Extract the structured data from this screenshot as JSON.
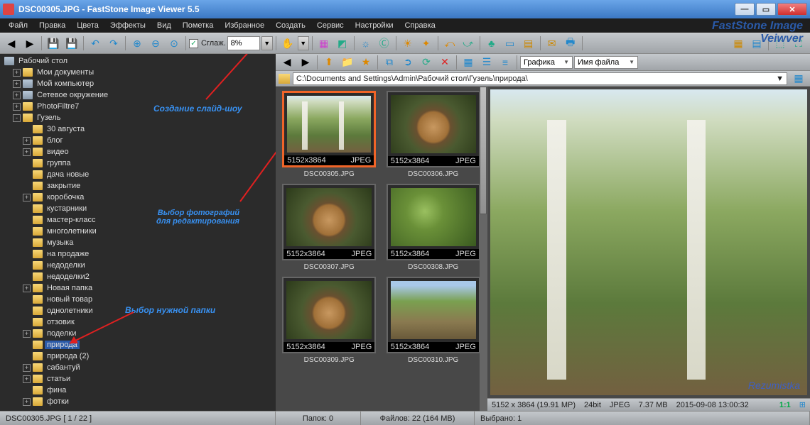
{
  "title": "DSC00305.JPG  -  FastStone Image Viewer 5.5",
  "brand1": "FastStone Image",
  "brand2": "Veiwver",
  "menu": [
    "Файл",
    "Правка",
    "Цвета",
    "Эффекты",
    "Вид",
    "Пометка",
    "Избранное",
    "Создать",
    "Сервис",
    "Настройки",
    "Справка"
  ],
  "toolbar": {
    "smooth_label": "Сглаж.",
    "zoom": "8%"
  },
  "tree_header": "Рабочий стол",
  "tree": [
    {
      "lv": 1,
      "exp": "+",
      "icon": "folder",
      "label": "Мои документы"
    },
    {
      "lv": 1,
      "exp": "+",
      "icon": "drive",
      "label": "Мой компьютер"
    },
    {
      "lv": 1,
      "exp": "+",
      "icon": "drive",
      "label": "Сетевое окружение"
    },
    {
      "lv": 1,
      "exp": "+",
      "icon": "folder",
      "label": "PhotoFiltre7"
    },
    {
      "lv": 1,
      "exp": "-",
      "icon": "folder",
      "label": "Гузель"
    },
    {
      "lv": 2,
      "exp": " ",
      "icon": "folder",
      "label": "30 августа"
    },
    {
      "lv": 2,
      "exp": "+",
      "icon": "folder",
      "label": "блог"
    },
    {
      "lv": 2,
      "exp": "+",
      "icon": "folder",
      "label": "видео"
    },
    {
      "lv": 2,
      "exp": " ",
      "icon": "folder",
      "label": "группа"
    },
    {
      "lv": 2,
      "exp": " ",
      "icon": "folder",
      "label": "дача новые"
    },
    {
      "lv": 2,
      "exp": " ",
      "icon": "folder",
      "label": "закрытие"
    },
    {
      "lv": 2,
      "exp": "+",
      "icon": "folder",
      "label": "коробочка"
    },
    {
      "lv": 2,
      "exp": " ",
      "icon": "folder",
      "label": "кустарники"
    },
    {
      "lv": 2,
      "exp": " ",
      "icon": "folder",
      "label": "мастер-класс"
    },
    {
      "lv": 2,
      "exp": " ",
      "icon": "folder",
      "label": "многолетники"
    },
    {
      "lv": 2,
      "exp": " ",
      "icon": "folder",
      "label": "музыка"
    },
    {
      "lv": 2,
      "exp": " ",
      "icon": "folder",
      "label": "на продаже"
    },
    {
      "lv": 2,
      "exp": " ",
      "icon": "folder",
      "label": "недоделки"
    },
    {
      "lv": 2,
      "exp": " ",
      "icon": "folder",
      "label": "недоделки2"
    },
    {
      "lv": 2,
      "exp": "+",
      "icon": "folder",
      "label": "Новая папка"
    },
    {
      "lv": 2,
      "exp": " ",
      "icon": "folder",
      "label": "новый товар"
    },
    {
      "lv": 2,
      "exp": " ",
      "icon": "folder",
      "label": "однолетники"
    },
    {
      "lv": 2,
      "exp": " ",
      "icon": "folder",
      "label": "отзовик"
    },
    {
      "lv": 2,
      "exp": "+",
      "icon": "folder",
      "label": "поделки"
    },
    {
      "lv": 2,
      "exp": " ",
      "icon": "folder",
      "label": "природа",
      "sel": true
    },
    {
      "lv": 2,
      "exp": " ",
      "icon": "folder",
      "label": "природа (2)"
    },
    {
      "lv": 2,
      "exp": "+",
      "icon": "folder",
      "label": "сабантуй"
    },
    {
      "lv": 2,
      "exp": "+",
      "icon": "folder",
      "label": "статьи"
    },
    {
      "lv": 2,
      "exp": " ",
      "icon": "folder",
      "label": "фина"
    },
    {
      "lv": 2,
      "exp": "+",
      "icon": "folder",
      "label": "фотки"
    }
  ],
  "annotations": {
    "a1": "Создание слайд-шоу",
    "a2_l1": "Выбор фотографий",
    "a2_l2": "для редактирования",
    "a3": "Выбор нужной папки"
  },
  "secondary": {
    "combo1": "Графика",
    "combo2": "Имя файла"
  },
  "path": "C:\\Documents and Settings\\Admin\\Рабочий стол\\Гузель\\природа\\",
  "thumbs": [
    {
      "name": "DSC00305.JPG",
      "dim": "5152x3864",
      "fmt": "JPEG",
      "sel": true,
      "cls": "forest"
    },
    {
      "name": "DSC00306.JPG",
      "dim": "5152x3864",
      "fmt": "JPEG",
      "cls": "mush"
    },
    {
      "name": "DSC00307.JPG",
      "dim": "5152x3864",
      "fmt": "JPEG",
      "cls": "mush"
    },
    {
      "name": "DSC00308.JPG",
      "dim": "5152x3864",
      "fmt": "JPEG",
      "cls": "moss"
    },
    {
      "name": "DSC00309.JPG",
      "dim": "5152x3864",
      "fmt": "JPEG",
      "cls": "mush"
    },
    {
      "name": "DSC00310.JPG",
      "dim": "5152x3864",
      "fmt": "JPEG",
      "cls": "path"
    }
  ],
  "preview": {
    "watermark": "Rezumistka",
    "info": {
      "dims": "5152 x 3864 (19.91 MP)",
      "depth": "24bit",
      "fmt": "JPEG",
      "size": "7.37 MB",
      "date": "2015-09-08 13:00:32",
      "ratio": "1:1"
    }
  },
  "status": {
    "file": "DSC00305.JPG  [ 1 / 22 ]",
    "folders": "Папок: 0",
    "files": "Файлов: 22 (164 MB)",
    "selected": "Выбрано: 1"
  }
}
